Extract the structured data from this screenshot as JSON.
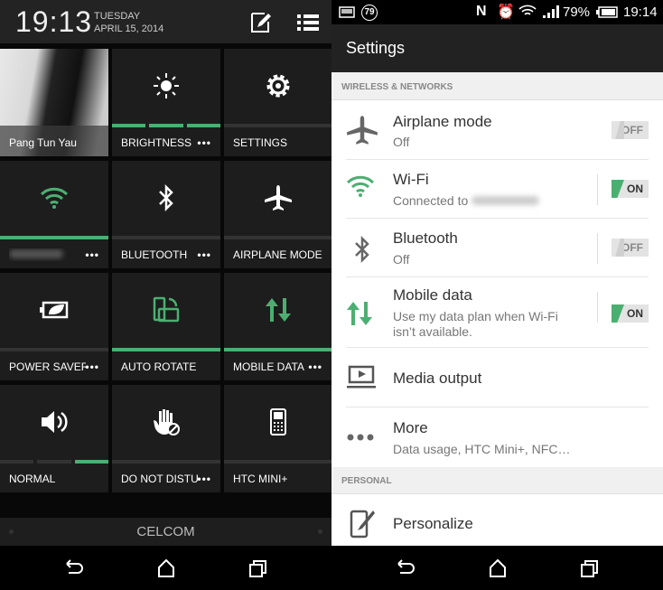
{
  "quick_settings": {
    "time": "19:13",
    "day": "TUESDAY",
    "date": "APRIL 15, 2014",
    "header_icons": [
      "edit-icon",
      "list-icon"
    ],
    "tiles": [
      {
        "label": "Pang Tun Yau",
        "type": "profile"
      },
      {
        "label": "BRIGHTNESS",
        "icon": "brightness-icon",
        "more": "•••",
        "bar": [
          true,
          true,
          true
        ]
      },
      {
        "label": "SETTINGS",
        "icon": "gear-icon",
        "bar": [
          false
        ]
      },
      {
        "label": "",
        "icon": "wifi-icon",
        "more": "•••",
        "bar": [
          true
        ],
        "active": true
      },
      {
        "label": "BLUETOOTH",
        "icon": "bluetooth-icon",
        "more": "•••",
        "bar": [
          false
        ]
      },
      {
        "label": "AIRPLANE MODE",
        "icon": "airplane-icon",
        "bar": [
          false
        ]
      },
      {
        "label": "POWER SAVER",
        "icon": "power-saver-icon",
        "more": "•••",
        "bar": [
          false
        ]
      },
      {
        "label": "AUTO ROTATE",
        "icon": "auto-rotate-icon",
        "bar": [
          true
        ],
        "active": true
      },
      {
        "label": "MOBILE DATA",
        "icon": "mobile-data-icon",
        "more": "•••",
        "bar": [
          true
        ],
        "active": true
      },
      {
        "label": "NORMAL",
        "icon": "volume-icon",
        "bar": [
          false,
          false,
          true
        ]
      },
      {
        "label": "DO NOT DISTURB",
        "icon": "do-not-disturb-icon",
        "more": "•••",
        "bar": [
          false
        ]
      },
      {
        "label": "HTC MINI+",
        "icon": "htc-mini-icon",
        "bar": [
          false
        ]
      }
    ],
    "carrier": "CELCOM"
  },
  "settings": {
    "status": {
      "notification_badge": "79",
      "battery": "79%",
      "time": "19:14"
    },
    "title": "Settings",
    "sections": [
      {
        "header": "WIRELESS & NETWORKS",
        "items": [
          {
            "title": "Airplane mode",
            "subtitle": "Off",
            "icon": "airplane-icon",
            "toggle": "OFF"
          },
          {
            "title": "Wi-Fi",
            "subtitle": "Connected to",
            "icon": "wifi-icon",
            "toggle": "ON"
          },
          {
            "title": "Bluetooth",
            "subtitle": "Off",
            "icon": "bluetooth-icon",
            "toggle": "OFF"
          },
          {
            "title": "Mobile data",
            "subtitle": "Use my data plan when Wi-Fi isn’t available.",
            "icon": "mobile-data-icon",
            "toggle": "ON"
          },
          {
            "title": "Media output",
            "icon": "media-output-icon"
          },
          {
            "title": "More",
            "subtitle": "Data usage, HTC Mini+, NFC…",
            "icon": "more-icon"
          }
        ]
      },
      {
        "header": "PERSONAL",
        "items": [
          {
            "title": "Personalize",
            "icon": "personalize-icon"
          }
        ]
      }
    ]
  },
  "colors": {
    "accent": "#4caf72",
    "tile_bg": "#1d1d1d",
    "action_bar": "#222222"
  }
}
